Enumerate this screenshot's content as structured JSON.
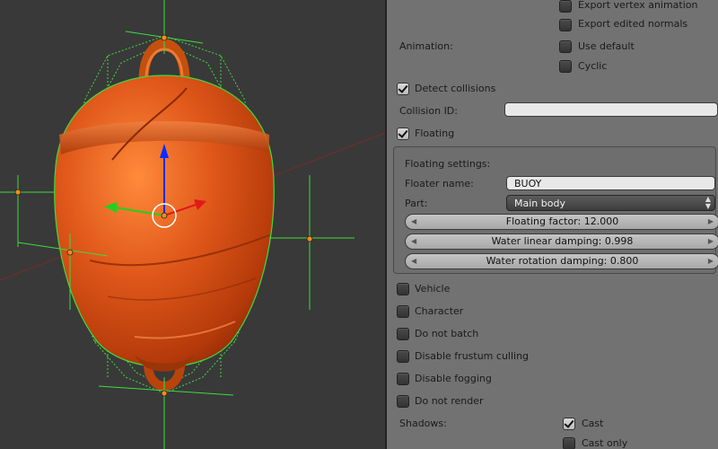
{
  "viewport": {
    "name": "3D viewport",
    "colors": {
      "background": "#393939",
      "object": "#c8480f",
      "wire": "#3ddc3d",
      "axis_z": "#0b2cff",
      "axis_y": "#1fd21f",
      "axis_x": "#e01a1a"
    }
  },
  "panel": {
    "export_vertex_animation": {
      "label": "Export vertex animation",
      "checked": false
    },
    "export_edited_normals": {
      "label": "Export edited normals",
      "checked": false
    },
    "animation": {
      "label": "Animation:",
      "use_default": {
        "label": "Use default",
        "checked": false
      },
      "cyclic": {
        "label": "Cyclic",
        "checked": false
      }
    },
    "detect_collisions": {
      "label": "Detect collisions",
      "checked": true
    },
    "collision_id": {
      "label": "Collision ID:",
      "value": ""
    },
    "floating": {
      "label": "Floating",
      "checked": true
    },
    "floating_settings": {
      "title": "Floating settings:",
      "floater_name": {
        "label": "Floater name:",
        "value": "BUOY"
      },
      "part": {
        "label": "Part:",
        "value": "Main body"
      },
      "floating_factor": "Floating factor: 12.000",
      "water_linear_damping": "Water linear damping: 0.998",
      "water_rotation_damping": "Water rotation damping: 0.800"
    },
    "options": [
      {
        "label": "Vehicle",
        "checked": false
      },
      {
        "label": "Character",
        "checked": false
      },
      {
        "label": "Do not batch",
        "checked": false
      },
      {
        "label": "Disable frustum culling",
        "checked": false
      },
      {
        "label": "Disable fogging",
        "checked": false
      },
      {
        "label": "Do not render",
        "checked": false
      }
    ],
    "shadows": {
      "label": "Shadows:",
      "cast": {
        "label": "Cast",
        "checked": true
      },
      "cast_only": {
        "label": "Cast only",
        "checked": false
      }
    }
  }
}
